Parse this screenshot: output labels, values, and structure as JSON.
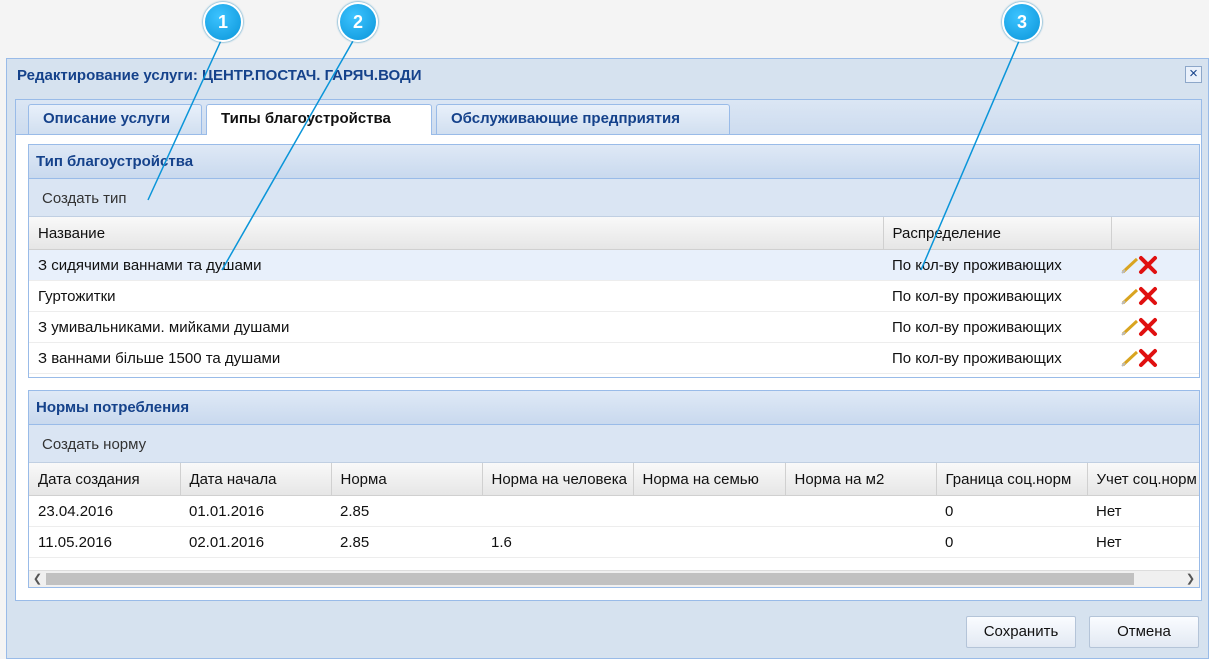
{
  "window": {
    "title": "Редактирование услуги: ЦЕНТР.ПОСТАЧ. ГАРЯЧ.ВОДИ",
    "close_glyph": "×"
  },
  "tabs": [
    {
      "label": "Описание услуги",
      "active": false
    },
    {
      "label": "Типы благоустройства",
      "active": true
    },
    {
      "label": "Обслуживающие предприятия",
      "active": false
    }
  ],
  "types_panel": {
    "title": "Тип благоустройства",
    "create_label": "Создать тип",
    "columns": [
      "Название",
      "Распределение"
    ],
    "rows": [
      {
        "name": "З сидячими ваннами та душами",
        "distribution": "По кол-ву проживающих"
      },
      {
        "name": "Гуртожитки",
        "distribution": "По кол-ву проживающих"
      },
      {
        "name": "З умивальниками. мийками душами",
        "distribution": "По кол-ву проживающих"
      },
      {
        "name": "З ваннами більше 1500 та душами",
        "distribution": "По кол-ву проживающих"
      }
    ],
    "row_icons": [
      "pencil-icon",
      "delete-icon"
    ]
  },
  "norms_panel": {
    "title": "Нормы потребления",
    "create_label": "Создать норму",
    "columns": [
      "Дата создания",
      "Дата начала",
      "Норма",
      "Норма на человека",
      "Норма на семью",
      "Норма на м2",
      "Граница соц.норм",
      "Учет соц.норм"
    ],
    "rows": [
      [
        "23.04.2016",
        "01.01.2016",
        "2.85",
        "",
        "",
        "",
        "0",
        "Нет"
      ],
      [
        "11.05.2016",
        "02.01.2016",
        "2.85",
        "1.6",
        "",
        "",
        "0",
        "Нет"
      ]
    ]
  },
  "buttons": {
    "save": "Сохранить",
    "cancel": "Отмена"
  },
  "callouts": [
    "1",
    "2",
    "3"
  ],
  "colors": {
    "accent": "#15428b",
    "border": "#99bbe8",
    "callout": "#0a95d9",
    "delete": "#e01010"
  }
}
